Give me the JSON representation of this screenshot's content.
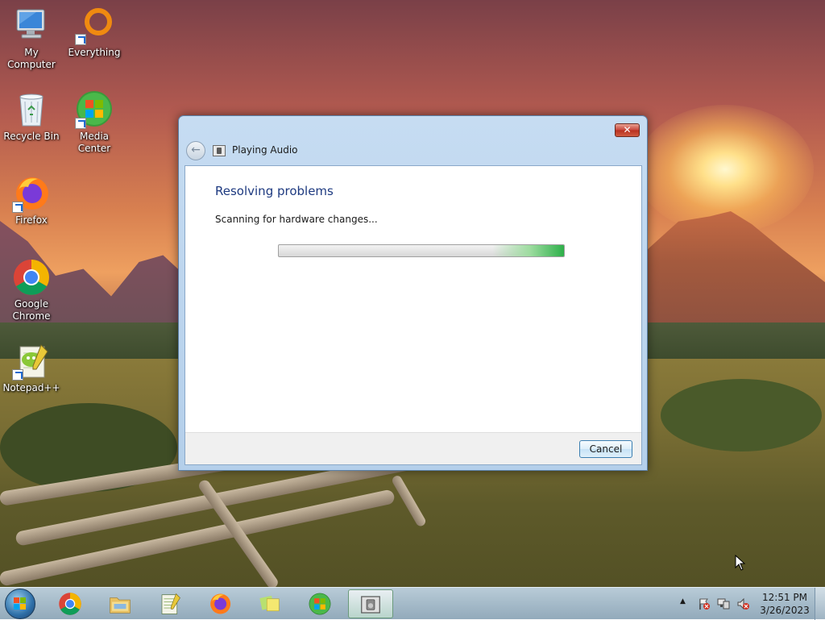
{
  "desktop": {
    "icons": [
      {
        "label": "My Computer",
        "icon": "computer-icon"
      },
      {
        "label": "Everything",
        "icon": "search-ring-icon"
      },
      {
        "label": "Recycle Bin",
        "icon": "recycle-bin-icon"
      },
      {
        "label": "Media Center",
        "icon": "windows-logo-icon"
      },
      {
        "label": "Firefox",
        "icon": "firefox-icon"
      },
      {
        "label": "Google Chrome",
        "icon": "chrome-icon"
      },
      {
        "label": "Notepad++",
        "icon": "notepad-plus-plus-icon"
      }
    ]
  },
  "dialog": {
    "title": "Playing Audio",
    "close_glyph": "✕",
    "back_glyph": "←",
    "heading": "Resolving problems",
    "status": "Scanning for hardware changes...",
    "progress_fraction": 1.0,
    "cancel_label": "Cancel"
  },
  "taskbar": {
    "items": [
      {
        "name": "chrome",
        "icon": "chrome-icon",
        "active": false
      },
      {
        "name": "file-explorer",
        "icon": "folder-icon",
        "active": false
      },
      {
        "name": "notepad-plus-plus",
        "icon": "notepad-plus-plus-icon",
        "active": false
      },
      {
        "name": "firefox",
        "icon": "firefox-icon",
        "active": false
      },
      {
        "name": "sticky-notes",
        "icon": "sticky-notes-icon",
        "active": false
      },
      {
        "name": "media-center",
        "icon": "windows-logo-icon",
        "active": false
      },
      {
        "name": "troubleshooter",
        "icon": "troubleshooter-icon",
        "active": true
      }
    ],
    "tray": {
      "show_hidden_glyph": "▲",
      "time": "12:51 PM",
      "date": "3/26/2023"
    }
  },
  "colors": {
    "heading": "#1e3a80",
    "progress_green": "#2eb04a",
    "close_red": "#c8453a"
  }
}
